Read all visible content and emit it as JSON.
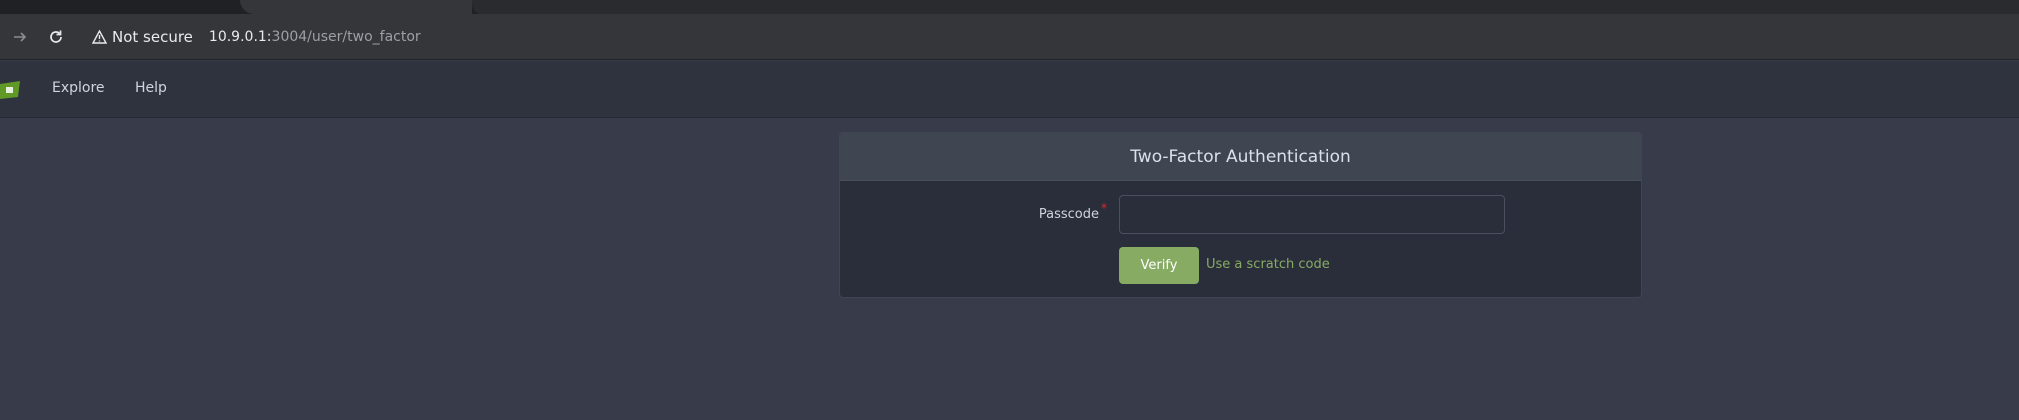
{
  "browser": {
    "security_label": "Not secure",
    "url_host": "10.9.0.1:",
    "url_rest": "3004/user/two_factor"
  },
  "header": {
    "nav": [
      {
        "label": "Explore"
      },
      {
        "label": "Help"
      }
    ]
  },
  "card": {
    "title": "Two-Factor Authentication",
    "passcode_label": "Passcode",
    "required_mark": "*",
    "passcode_value": "",
    "verify_label": "Verify",
    "scratch_link": "Use a scratch code"
  },
  "colors": {
    "accent": "#87ab63",
    "background": "#383c4a",
    "header_bg": "#2f333e",
    "card_header_bg": "#404552",
    "required": "#db2828"
  }
}
